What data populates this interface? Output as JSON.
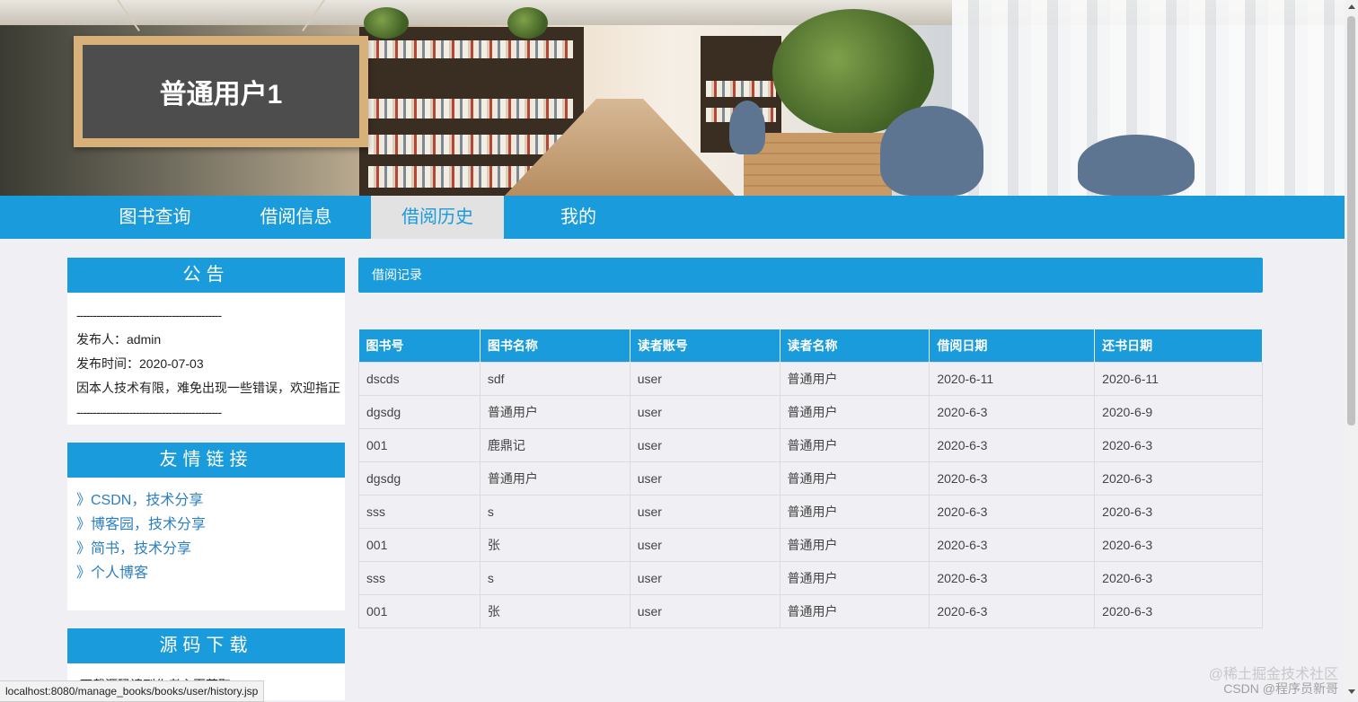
{
  "banner": {
    "sign_text": "普通用户1"
  },
  "nav": {
    "items": [
      "图书查询",
      "借阅信息",
      "借阅历史",
      "我的"
    ],
    "active_index": 2
  },
  "notice": {
    "title": "公告",
    "divider": "--------------------------------------------",
    "publisher": "发布人：admin",
    "publish_time": "发布时间：2020-07-03",
    "content": "因本人技术有限，难免出现一些错误，欢迎指正",
    "divider_end": "--------------------------------------------"
  },
  "links": {
    "title": "友情链接",
    "items": [
      "》CSDN，技术分享",
      "》博客园，技术分享",
      "》简书，技术分享",
      "》个人博客"
    ]
  },
  "download": {
    "title": "源码下载",
    "text": "下载源码请到作者主页获取"
  },
  "main": {
    "section_title": "借阅记录",
    "columns": [
      "图书号",
      "图书名称",
      "读者账号",
      "读者名称",
      "借阅日期",
      "还书日期"
    ],
    "rows": [
      [
        "dscds",
        "sdf",
        "user",
        "普通用户",
        "2020-6-11",
        "2020-6-11"
      ],
      [
        "dgsdg",
        "普通用户",
        "user",
        "普通用户",
        "2020-6-3",
        "2020-6-9"
      ],
      [
        "001",
        "鹿鼎记",
        "user",
        "普通用户",
        "2020-6-3",
        "2020-6-3"
      ],
      [
        "dgsdg",
        "普通用户",
        "user",
        "普通用户",
        "2020-6-3",
        "2020-6-3"
      ],
      [
        "sss",
        "s",
        "user",
        "普通用户",
        "2020-6-3",
        "2020-6-3"
      ],
      [
        "001",
        "张",
        "user",
        "普通用户",
        "2020-6-3",
        "2020-6-3"
      ],
      [
        "sss",
        "s",
        "user",
        "普通用户",
        "2020-6-3",
        "2020-6-3"
      ],
      [
        "001",
        "张",
        "user",
        "普通用户",
        "2020-6-3",
        "2020-6-3"
      ]
    ]
  },
  "status_bar": {
    "url": "localhost:8080/manage_books/books/user/history.jsp"
  },
  "watermarks": {
    "line1": "@稀土掘金技术社区",
    "line2": "CSDN @程序员新哥"
  },
  "colors": {
    "primary": "#1a9bdb",
    "page_bg": "#f0eff4",
    "link": "#2b7fc1"
  }
}
